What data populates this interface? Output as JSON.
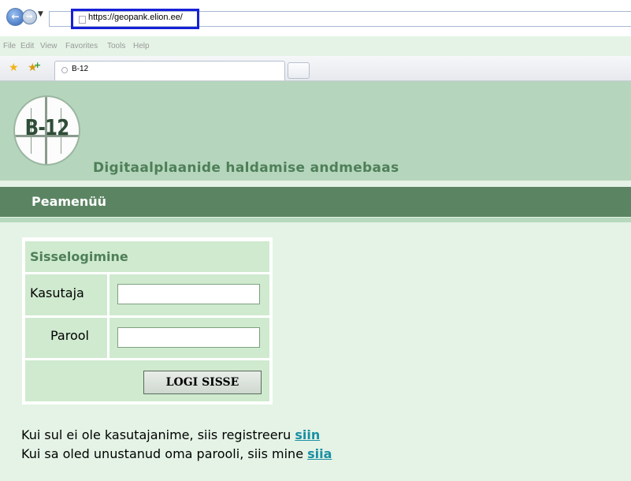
{
  "browser": {
    "address_url": "https://geopank.elion.ee/",
    "menu": [
      "File",
      "Edit",
      "View",
      "Favorites",
      "Tools",
      "Help"
    ],
    "tab_title": "B-12"
  },
  "header": {
    "logo_text": "B-12",
    "site_title": "Digitaalplaanide haldamise andmebaas"
  },
  "nav": {
    "main_menu": "Peamenüü"
  },
  "login": {
    "title": "Sisselogimine",
    "username_label": "Kasutaja",
    "username_value": "",
    "password_label": "Parool",
    "password_value": "",
    "submit_label": "LOGI SISSE"
  },
  "info": {
    "register_text": "Kui sul ei ole kasutajanime, siis registreeru ",
    "register_link": "siin",
    "forgot_text": "Kui sa oled unustanud oma parooli, siis mine ",
    "forgot_link": "siia"
  },
  "colors": {
    "header_bg": "#b5d6bd",
    "menu_bg": "#5b8562",
    "page_bg": "#e4f3e5",
    "title_green": "#4f7f58",
    "link": "#1a8fa4",
    "address_highlight": "#1520d8"
  }
}
